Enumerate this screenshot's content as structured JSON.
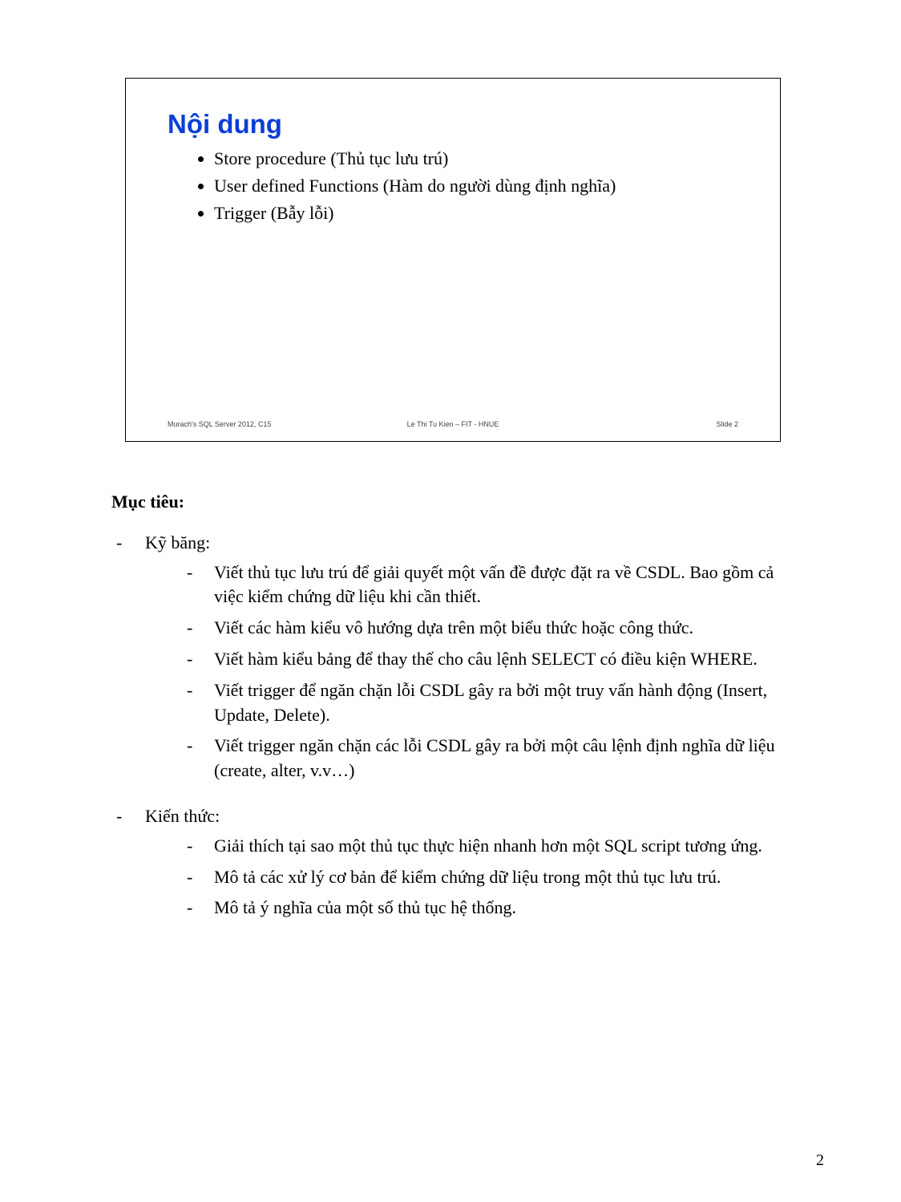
{
  "slide": {
    "title": "Nội dung",
    "items": [
      "Store procedure (Thủ tục lưu trú)",
      "User defined Functions (Hàm do người dùng định nghĩa)",
      "Trigger (Bẫy lỗi)"
    ],
    "footer_left": "Murach's SQL Server 2012, C15",
    "footer_center": "Le Thi Tu Kien – FIT - HNUE",
    "footer_right": "Slide 2"
  },
  "heading": "Mục tiêu:",
  "sections": [
    {
      "label": "Kỹ băng:",
      "items": [
        "Viết thủ tục lưu trú để giải quyết một vấn đề được đặt ra về CSDL. Bao gồm cả việc kiểm chứng dữ liệu khi cần thiết.",
        "Viết các hàm kiểu vô hướng dựa trên một biểu thức hoặc công thức.",
        "Viết hàm kiểu bảng để thay thế cho câu lệnh SELECT có điều kiện WHERE.",
        "Viết trigger để ngăn chặn lỗi CSDL gây ra bởi một truy vấn hành động (Insert, Update, Delete).",
        "Viết trigger ngăn chặn các lỗi CSDL gây ra bởi một câu lệnh định nghĩa dữ liệu (create, alter, v.v…)"
      ]
    },
    {
      "label": "Kiến thức:",
      "items": [
        "Giải thích tại sao một thủ tục thực hiện nhanh hơn một SQL script tương ứng.",
        "Mô tả các xử lý cơ bản để kiểm chứng dữ liệu trong một thủ tục lưu trú.",
        "Mô tả ý nghĩa của một số thủ tục hệ thống."
      ]
    }
  ],
  "page_number": "2"
}
